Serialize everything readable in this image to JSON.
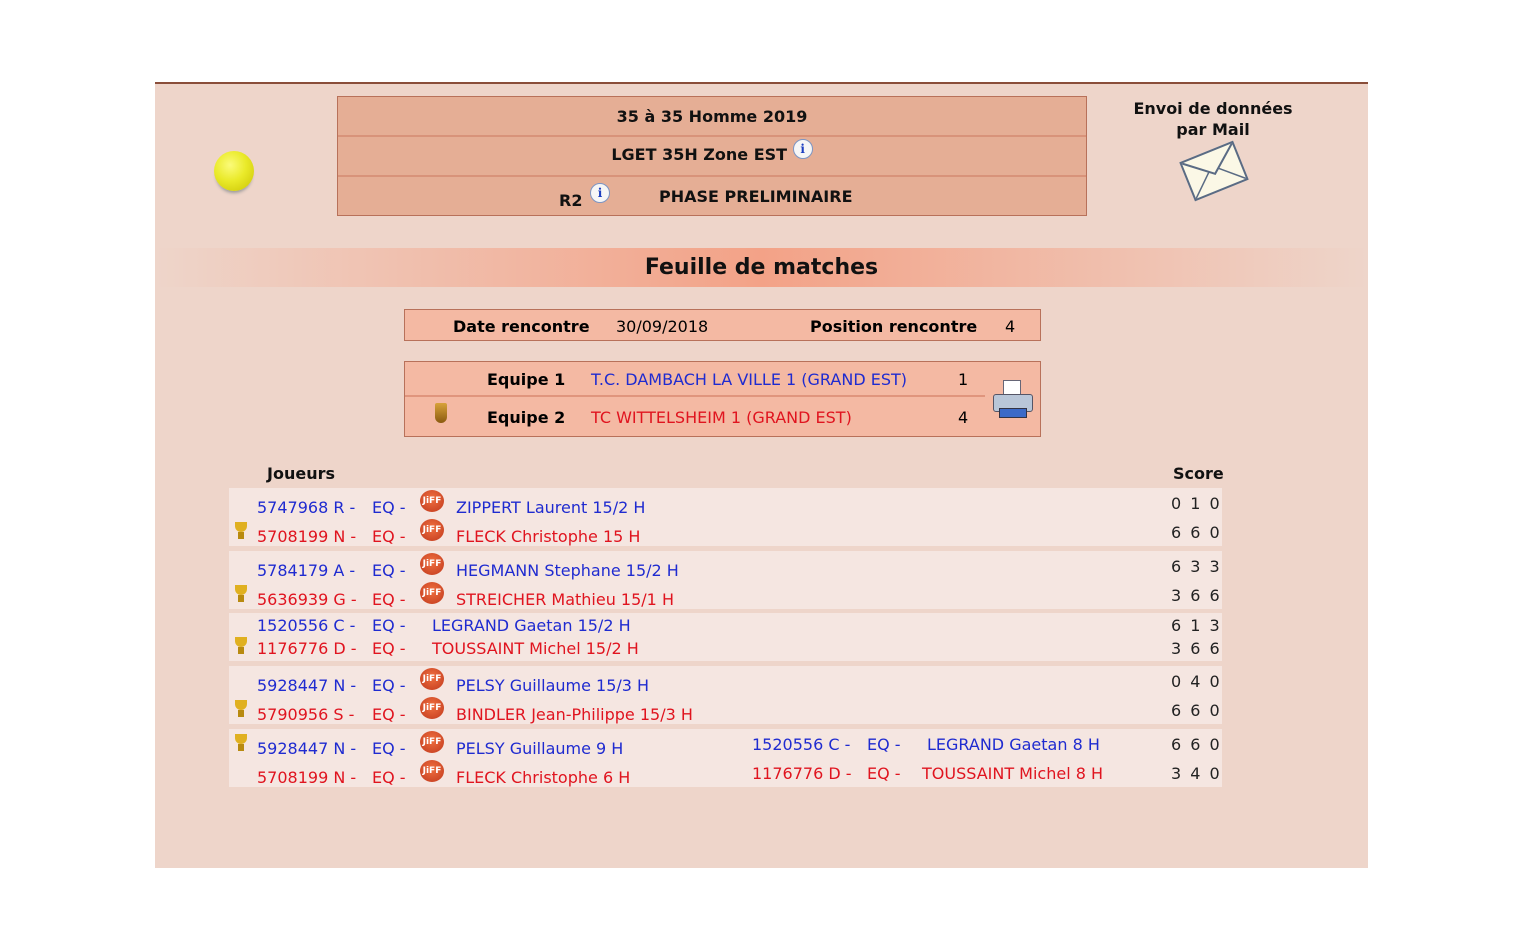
{
  "header": {
    "line1": "35  à 35  Homme  2019",
    "line2": "LGET 35H Zone EST",
    "level": "R2",
    "phase": "PHASE PRELIMINAIRE",
    "info_glyph": "i"
  },
  "mail": {
    "line1": "Envoi de données",
    "line2": "par Mail"
  },
  "title": "Feuille de matches",
  "rencontre": {
    "date_label": "Date rencontre",
    "date_value": "30/09/2018",
    "position_label": "Position rencontre",
    "position_value": "4"
  },
  "teams": {
    "team1_label": "Equipe 1",
    "team1_name": "T.C. DAMBACH LA VILLE 1 (GRAND EST)",
    "team1_score": "1",
    "team2_label": "Equipe 2",
    "team2_name": "TC WITTELSHEIM 1 (GRAND EST)",
    "team2_score": "4"
  },
  "columns": {
    "players": "Joueurs",
    "score": "Score"
  },
  "icons": {
    "jiff": "JiFF",
    "ball": "tennis-ball-icon",
    "mail": "envelope-icon",
    "printer": "printer-icon",
    "trophy": "trophy-icon"
  },
  "matches": [
    {
      "p1": {
        "licence": "5747968 R -",
        "eq": "EQ -",
        "name": "ZIPPERT  Laurent  15/2 H",
        "score": "0 1 0"
      },
      "p2": {
        "licence": "5708199 N -",
        "eq": "EQ -",
        "name": "FLECK  Christophe 15 H",
        "score": "6 6 0"
      }
    },
    {
      "p1": {
        "licence": "5784179 A -",
        "eq": "EQ -",
        "name": "HEGMANN  Stephane  15/2 H",
        "score": "6 3 3"
      },
      "p2": {
        "licence": "5636939 G -",
        "eq": "EQ -",
        "name": "STREICHER  Mathieu 15/1 H",
        "score": "3 6 6"
      }
    },
    {
      "p1": {
        "licence": "1520556 C -",
        "eq": "EQ -",
        "name": "LEGRAND  Gaetan  15/2 H",
        "score": "6 1 3"
      },
      "p2": {
        "licence": "1176776 D -",
        "eq": "EQ -",
        "name": "TOUSSAINT  Michel 15/2 H",
        "score": "3 6 6"
      }
    },
    {
      "p1": {
        "licence": "5928447 N -",
        "eq": "EQ -",
        "name": "PELSY  Guillaume  15/3 H",
        "score": "0 4 0"
      },
      "p2": {
        "licence": "5790956 S -",
        "eq": "EQ -",
        "name": "BINDLER  Jean-Philippe 15/3 H",
        "score": "6 6 0"
      }
    },
    {
      "p1": {
        "licence": "5928447 N -",
        "eq": "EQ -",
        "name": "PELSY  Guillaume  9 H",
        "partner_licence": "1520556 C -",
        "partner_eq": "EQ -",
        "partner_name": "LEGRAND  Gaetan  8 H",
        "score": "6 6 0"
      },
      "p2": {
        "licence": "5708199 N -",
        "eq": "EQ -",
        "name": "FLECK  Christophe 6 H",
        "partner_licence": "1176776 D -",
        "partner_eq": "EQ -",
        "partner_name": "TOUSSAINT  Michel 8 H",
        "score": "3 4 0"
      }
    }
  ]
}
